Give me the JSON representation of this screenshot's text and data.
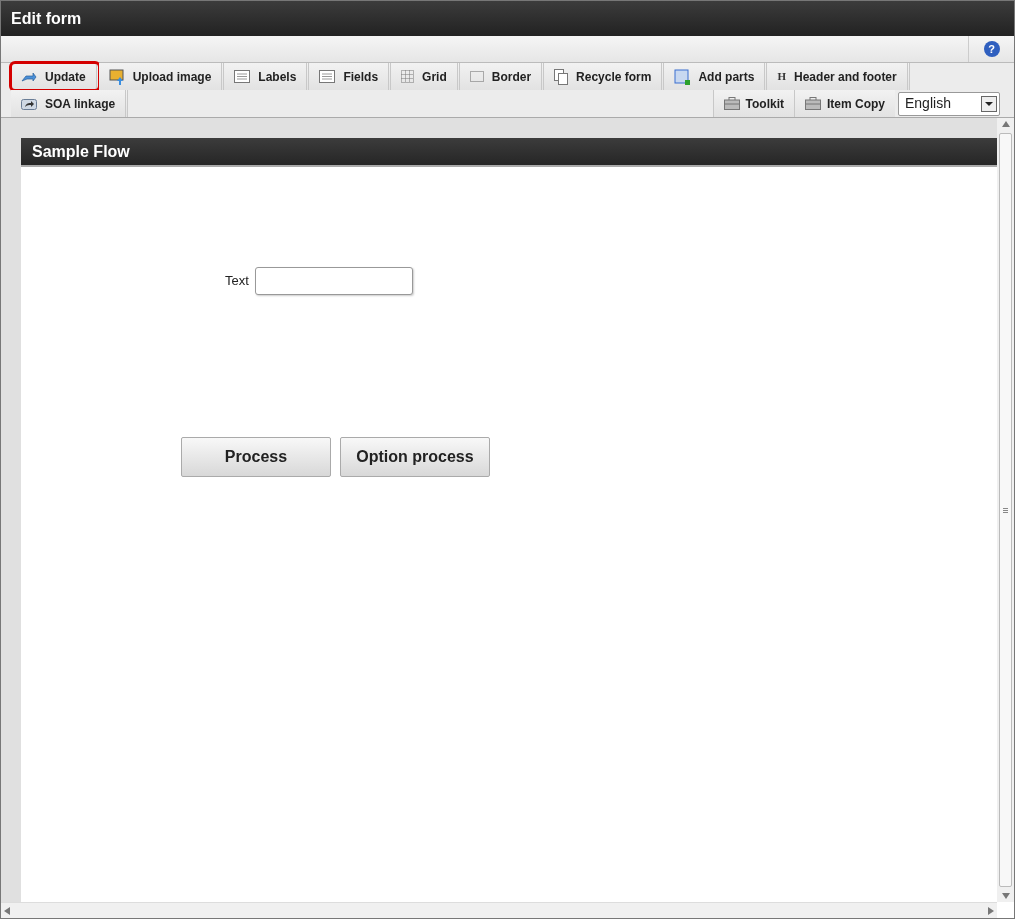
{
  "window": {
    "title": "Edit form"
  },
  "help": {
    "label": "?"
  },
  "toolbar": {
    "tabs": [
      {
        "label": "Update",
        "kind": "update",
        "highlighted": true
      },
      {
        "label": "Upload image",
        "kind": "image",
        "highlighted": false
      },
      {
        "label": "Labels",
        "kind": "list",
        "highlighted": false
      },
      {
        "label": "Fields",
        "kind": "list",
        "highlighted": false
      },
      {
        "label": "Grid",
        "kind": "grid",
        "highlighted": false
      },
      {
        "label": "Border",
        "kind": "border",
        "highlighted": false
      },
      {
        "label": "Recycle form",
        "kind": "pages",
        "highlighted": false
      },
      {
        "label": "Add parts",
        "kind": "parts",
        "highlighted": false
      },
      {
        "label": "Header and footer",
        "kind": "glyph",
        "glyph": "H",
        "highlighted": false
      },
      {
        "label": "SOA linkage",
        "kind": "share",
        "highlighted": false
      }
    ],
    "right_tabs": [
      {
        "label": "Toolkit"
      },
      {
        "label": "Item Copy"
      }
    ],
    "language": {
      "value": "English"
    }
  },
  "panel": {
    "title": "Sample Flow",
    "field": {
      "label": "Text"
    },
    "buttons": [
      "Process",
      "Option process"
    ]
  }
}
